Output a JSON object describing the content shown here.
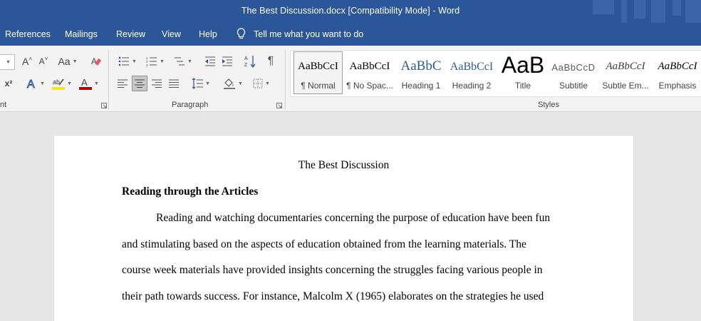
{
  "window": {
    "title": "The Best Discussion.docx [Compatibility Mode]  -  Word"
  },
  "menu": {
    "items": [
      "References",
      "Mailings",
      "Review",
      "View",
      "Help"
    ],
    "tell_me": "Tell me what you want to do"
  },
  "ribbon": {
    "font_group_label": "nt",
    "paragraph_label": "Paragraph",
    "styles_label": "Styles",
    "font_buttons": {
      "grow": "A",
      "shrink": "A",
      "case": "Aa",
      "superscript": "x²",
      "font_color": "A"
    },
    "styles": [
      {
        "sample": "AaBbCcI",
        "name": "¶ Normal"
      },
      {
        "sample": "AaBbCcI",
        "name": "¶ No Spac..."
      },
      {
        "sample": "AaBbC",
        "name": "Heading 1"
      },
      {
        "sample": "AaBbCcI",
        "name": "Heading 2"
      },
      {
        "sample": "AaB",
        "name": "Title"
      },
      {
        "sample": "AaBbCcD",
        "name": "Subtitle"
      },
      {
        "sample": "AaBbCcI",
        "name": "Subtle Em..."
      },
      {
        "sample": "AaBbCcI",
        "name": "Emphasis"
      }
    ],
    "colors": {
      "highlight": "#f5e51a",
      "font_color": "#c00000"
    }
  },
  "document": {
    "title": "The Best Discussion",
    "heading": "Reading through the Articles",
    "lines": [
      "Reading and watching documentaries concerning the purpose of education have been fun",
      "and stimulating based on the aspects of education obtained from the learning materials. The",
      "course week materials have provided insights concerning the struggles facing various people in",
      "their path towards success. For instance, Malcolm X (1965) elaborates on the strategies he used"
    ]
  },
  "theme": {
    "title_bar": "#2b579a",
    "ribbon_bg": "#f3f3f3",
    "canvas_bg": "#e6e6e6"
  }
}
